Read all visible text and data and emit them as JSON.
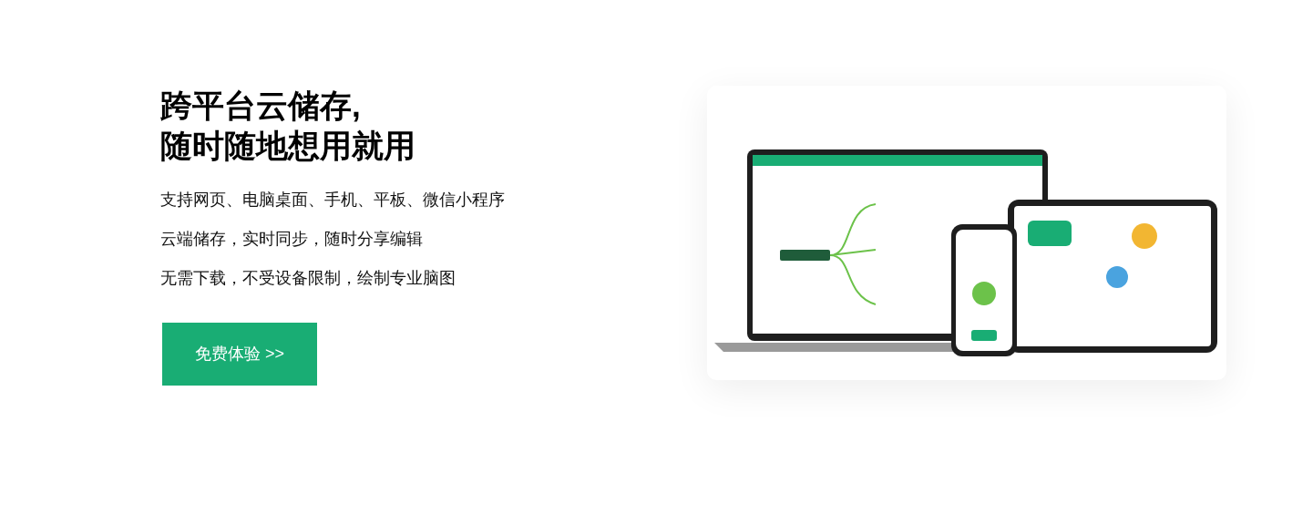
{
  "heading": {
    "lines": [
      "跨平台云储存,",
      "随时随地想用就用"
    ]
  },
  "features": [
    "支持网页、电脑桌面、手机、平板、微信小程序",
    "云端储存，实时同步，随时分享编辑",
    "无需下载，不受设备限制，绘制专业脑图"
  ],
  "cta_button": {
    "label": "免费体验 >>"
  }
}
